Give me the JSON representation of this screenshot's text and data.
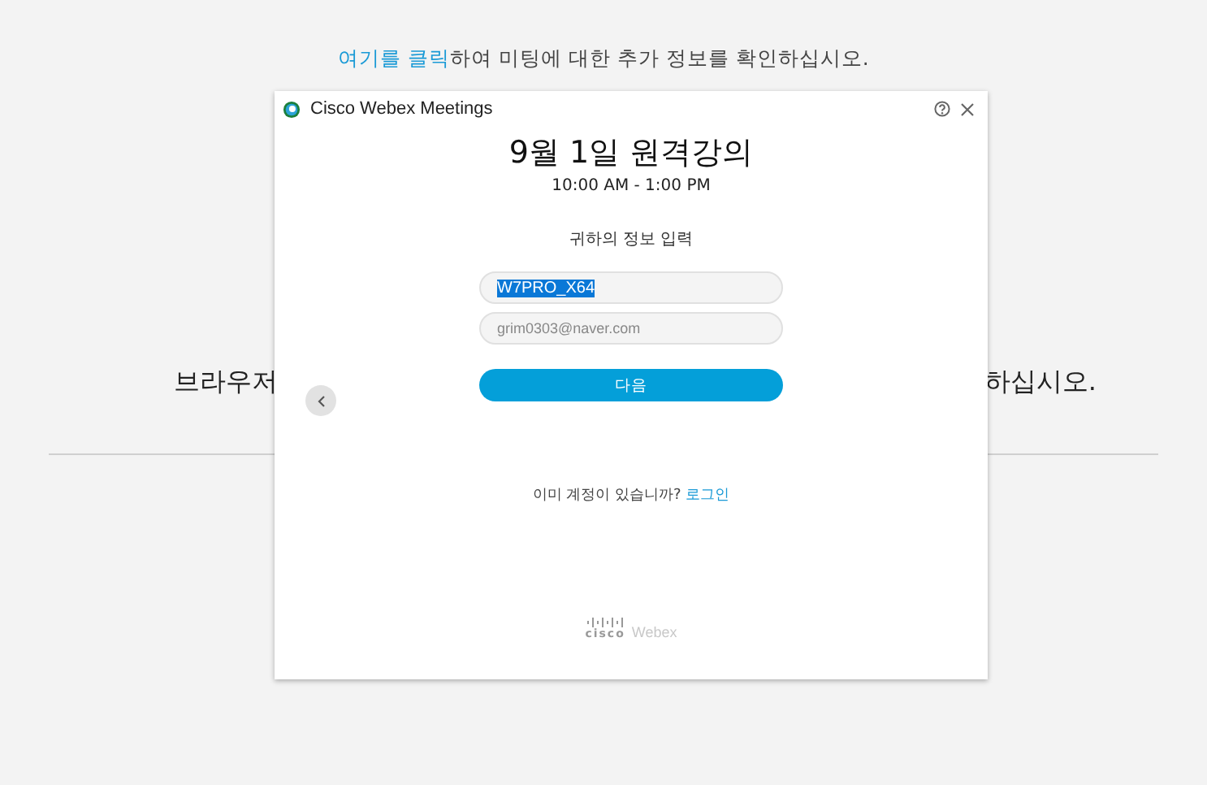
{
  "page": {
    "info_link": "여기를 클릭",
    "info_text": "하여 미팅에 대한 추가 정보를 확인하십시오.",
    "partial_left": "브라우저",
    "partial_right": "하십시오."
  },
  "dialog": {
    "title": "Cisco Webex Meetings",
    "meeting_title": "9월 1일 원격강의",
    "time": "10:00 AM - 1:00 PM",
    "prompt": "귀하의 정보 입력",
    "fields": [
      {
        "value": "W7PRO_X64",
        "selected": true
      },
      {
        "placeholder": "grim0303@naver.com",
        "selected": false
      }
    ],
    "next_button": "다음",
    "account_question": "이미 계정이 있습니까?",
    "login_link": "로그인",
    "logo_cisco": "cisco",
    "logo_webex": "Webex"
  }
}
